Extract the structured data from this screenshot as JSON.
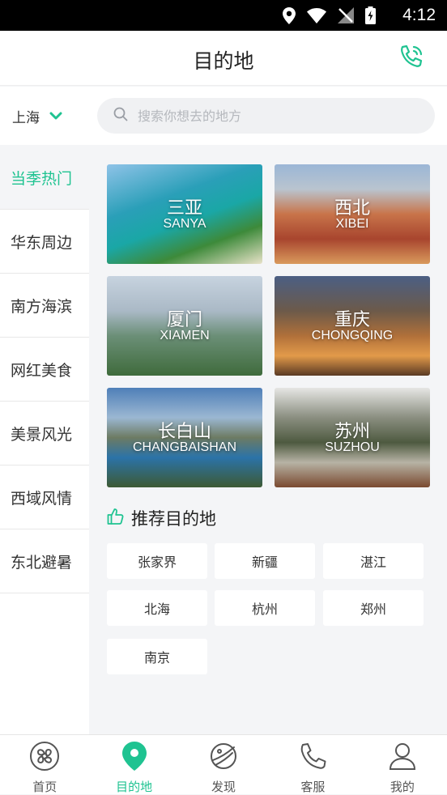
{
  "statusbar": {
    "time": "4:12",
    "icons": [
      "location-icon",
      "wifi-icon",
      "no-signal-icon",
      "battery-charging-icon"
    ]
  },
  "header": {
    "title": "目的地",
    "phone_icon": "phone-icon"
  },
  "city": {
    "name": "上海"
  },
  "search": {
    "placeholder": "搜索你想去的地方"
  },
  "sidebar": {
    "items": [
      {
        "label": "当季热门",
        "active": true
      },
      {
        "label": "华东周边"
      },
      {
        "label": "南方海滨"
      },
      {
        "label": "网红美食"
      },
      {
        "label": "美景风光"
      },
      {
        "label": "西域风情"
      },
      {
        "label": "东北避暑"
      }
    ]
  },
  "destinations": [
    {
      "zh": "三亚",
      "en": "SANYA"
    },
    {
      "zh": "西北",
      "en": "XIBEI"
    },
    {
      "zh": "厦门",
      "en": "XIAMEN"
    },
    {
      "zh": "重庆",
      "en": "CHONGQING"
    },
    {
      "zh": "长白山",
      "en": "CHANGBAISHAN"
    },
    {
      "zh": "苏州",
      "en": "SUZHOU"
    }
  ],
  "recommend": {
    "title": "推荐目的地",
    "tags": [
      "张家界",
      "新疆",
      "湛江",
      "北海",
      "杭州",
      "郑州",
      "南京"
    ]
  },
  "tabbar": {
    "tabs": [
      {
        "label": "首页"
      },
      {
        "label": "目的地",
        "active": true
      },
      {
        "label": "发现"
      },
      {
        "label": "客服"
      },
      {
        "label": "我的"
      }
    ]
  },
  "colors": {
    "accent": "#1fc391",
    "background": "#f4f5f7"
  }
}
